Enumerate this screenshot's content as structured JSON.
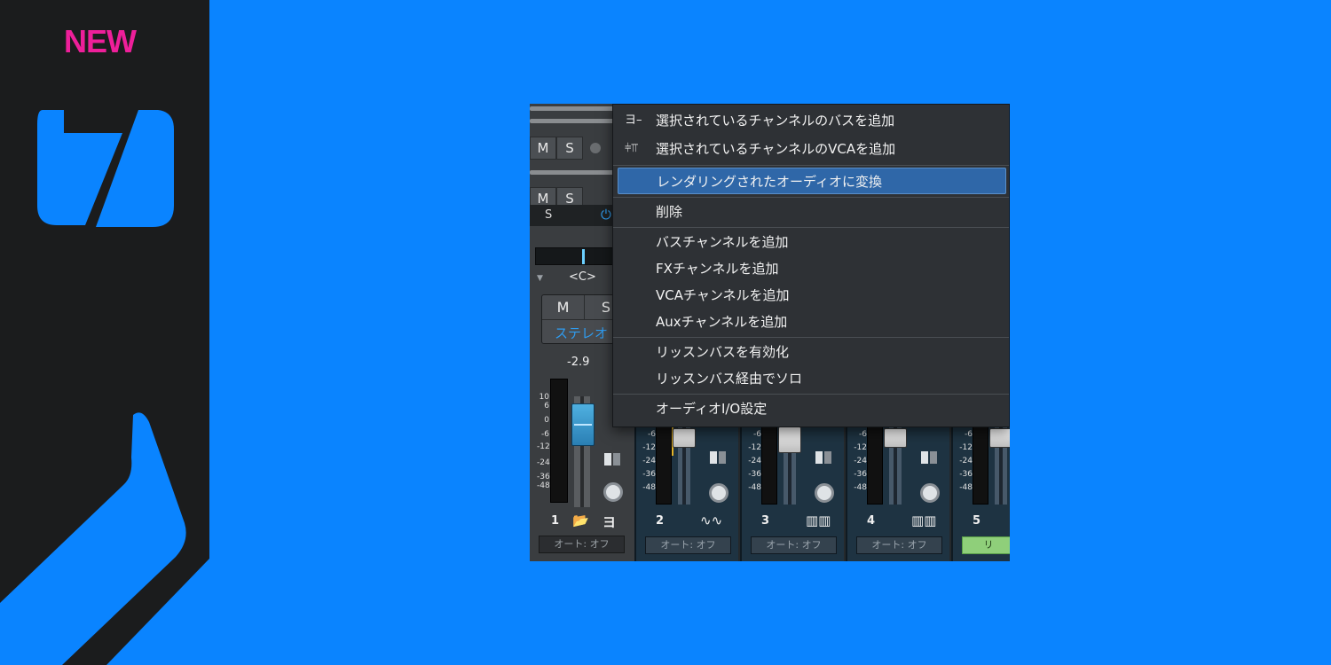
{
  "banner": {
    "badge": "NEW"
  },
  "mixer": {
    "top_rows": [
      {
        "m": "M",
        "s": "S"
      },
      {
        "m": "M",
        "s": "S"
      }
    ],
    "s_label": "S",
    "pan_value": "<C>",
    "mute_label": "M",
    "solo_label": "S",
    "stereo_label": "ステレオ",
    "volume_readout": "-2.9",
    "meter_scale": [
      "10",
      "6",
      "0",
      "-6",
      "-12",
      "-24",
      "-36",
      "-48"
    ],
    "strip_scale": [
      "-6",
      "-12",
      "-24",
      "-36",
      "-48"
    ],
    "channels": [
      {
        "number": "1",
        "auto": "オート: オフ"
      },
      {
        "number": "2",
        "icon": "waveform-icon",
        "auto": "オート: オフ"
      },
      {
        "number": "3",
        "icon": "keyboard-icon",
        "auto": "オート: オフ"
      },
      {
        "number": "4",
        "icon": "keyboard-icon",
        "auto": "オート: オフ"
      },
      {
        "number": "5",
        "auto": "リ"
      }
    ]
  },
  "context_menu": {
    "items": [
      {
        "label": "選択されているチャンネルのバスを追加",
        "icon": "bus-icon"
      },
      {
        "label": "選択されているチャンネルのVCAを追加",
        "icon": "vca-icon"
      },
      {
        "label": "レンダリングされたオーディオに変換",
        "highlighted": true
      },
      {
        "label": "削除"
      },
      {
        "label": "バスチャンネルを追加"
      },
      {
        "label": "FXチャンネルを追加"
      },
      {
        "label": "VCAチャンネルを追加"
      },
      {
        "label": "Auxチャンネルを追加"
      },
      {
        "label": "リッスンバスを有効化"
      },
      {
        "label": "リッスンバス経由でソロ"
      },
      {
        "label": "オーディオI/O設定"
      }
    ]
  },
  "colors": {
    "background": "#0a84ff",
    "sidebar": "#1b1c1d",
    "badge": "#ee1f9a",
    "menu_highlight": "#2f67a8",
    "accent": "#2f9cf0"
  }
}
